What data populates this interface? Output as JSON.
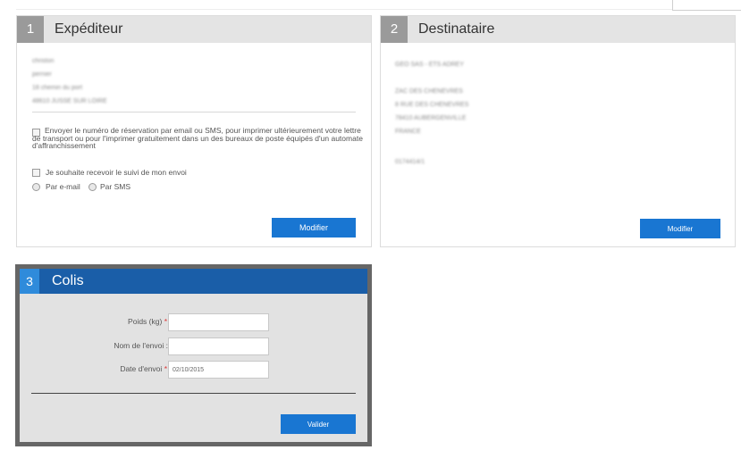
{
  "sender": {
    "number": "1",
    "title": "Expéditeur",
    "address_lines": [
      "christon",
      "pernier",
      "18 chemin du port",
      "48610 JUSSE SUR LOIRE"
    ],
    "notify_option": "Envoyer le numéro de réservation par email ou SMS, pour imprimer ultérieurement votre lettre de transport ou pour l'imprimer gratuitement dans un des bureaux de poste équipés d'un automate d'affranchissement",
    "tracking_option": "Je souhaite recevoir le suivi de mon envoi",
    "by_email": "Par e-mail",
    "by_sms": "Par SMS",
    "modify_label": "Modifier"
  },
  "recipient": {
    "number": "2",
    "title": "Destinataire",
    "address_lines": [
      "GEO SAS - ETS ADREY",
      "ZAC DES CHENEVRES",
      "8 RUE DES CHENEVRES",
      "78410 AUBERGENVILLE",
      "FRANCE",
      "0174414/1"
    ],
    "modify_label": "Modifier"
  },
  "parcel": {
    "number": "3",
    "title": "Colis",
    "weight_label": "Poids (kg)",
    "weight_value": "",
    "name_label": "Nom de l'envoi :",
    "name_value": "",
    "date_label": "Date d'envoi",
    "date_value": "02/10/2015",
    "required_mark": "*",
    "validate_label": "Valider"
  },
  "colors": {
    "header_grey": "#e4e4e4",
    "number_grey": "#9a9a9a",
    "active_blue": "#1a5ea8",
    "button_blue": "#1976d2"
  }
}
